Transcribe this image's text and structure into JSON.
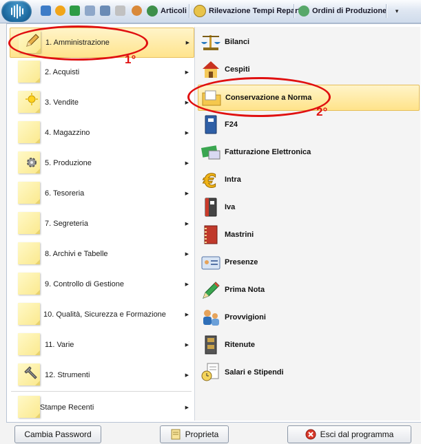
{
  "toolbar": {
    "articoli": "Articoli",
    "rilevazione": "Rilevazione Tempi Reparto",
    "ordini": "Ordini di Produzione",
    "dropdown": "▾"
  },
  "left_menu": [
    {
      "label": "1. Amministrazione",
      "icon": "pencil-icon"
    },
    {
      "label": "2. Acquisti",
      "icon": "note-icon"
    },
    {
      "label": "3. Vendite",
      "icon": "sun-icon"
    },
    {
      "label": "4. Magazzino",
      "icon": "note-icon"
    },
    {
      "label": "5. Produzione",
      "icon": "gear-icon"
    },
    {
      "label": "6. Tesoreria",
      "icon": "note-icon"
    },
    {
      "label": "7. Segreteria",
      "icon": "note-icon"
    },
    {
      "label": "8. Archivi e Tabelle",
      "icon": "note-icon"
    },
    {
      "label": "9. Controllo di Gestione",
      "icon": "note-icon"
    },
    {
      "label": "10. Qualità, Sicurezza e Formazione",
      "icon": "note-icon"
    },
    {
      "label": "11. Varie",
      "icon": "note-icon"
    },
    {
      "label": "12. Strumenti",
      "icon": "wrench-icon"
    },
    {
      "label": "Stampe Recenti",
      "icon": "note-icon"
    }
  ],
  "right_menu": [
    {
      "label": "Bilanci",
      "icon": "scales-icon"
    },
    {
      "label": "Cespiti",
      "icon": "house-icon"
    },
    {
      "label": "Conservazione a Norma",
      "icon": "folder-icon"
    },
    {
      "label": "F24",
      "icon": "binder-icon"
    },
    {
      "label": "Fatturazione Elettronica",
      "icon": "invoice-icon"
    },
    {
      "label": "Intra",
      "icon": "euro-icon"
    },
    {
      "label": "Iva",
      "icon": "binder-icon"
    },
    {
      "label": "Mastrini",
      "icon": "ledger-icon"
    },
    {
      "label": "Presenze",
      "icon": "badge-icon"
    },
    {
      "label": "Prima Nota",
      "icon": "pencil-icon"
    },
    {
      "label": "Provvigioni",
      "icon": "people-icon"
    },
    {
      "label": "Ritenute",
      "icon": "cabinet-icon"
    },
    {
      "label": "Salari e Stipendi",
      "icon": "clock-doc-icon"
    }
  ],
  "buttons": {
    "cambia_password": "Cambia Password",
    "proprieta": "Proprieta",
    "esci": "Esci dal programma"
  },
  "annotations": {
    "first": "1°",
    "second": "2°"
  },
  "colors": {
    "highlight": "#ffe48d",
    "annotation": "#e01010"
  }
}
